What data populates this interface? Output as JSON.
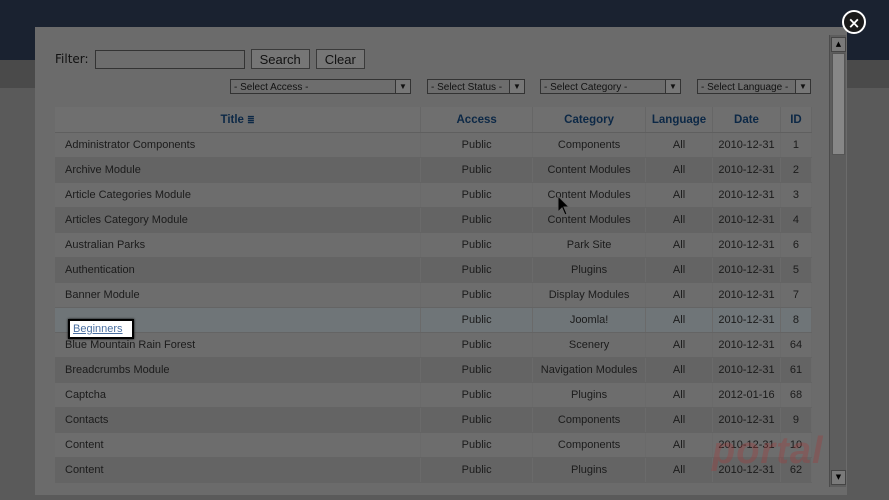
{
  "filter": {
    "label": "Filter:",
    "value": "",
    "placeholder": "",
    "search_label": "Search",
    "clear_label": "Clear"
  },
  "selects": {
    "access": "- Select Access -",
    "status": "- Select Status -",
    "category": "- Select Category -",
    "language": "- Select Language -"
  },
  "table": {
    "headers": {
      "title": "Title",
      "access": "Access",
      "category": "Category",
      "language": "Language",
      "date": "Date",
      "id": "ID"
    },
    "rows": [
      {
        "title": "Administrator Components",
        "access": "Public",
        "category": "Components",
        "language": "All",
        "date": "2010-12-31",
        "id": "1"
      },
      {
        "title": "Archive Module",
        "access": "Public",
        "category": "Content Modules",
        "language": "All",
        "date": "2010-12-31",
        "id": "2"
      },
      {
        "title": "Article Categories Module",
        "access": "Public",
        "category": "Content Modules",
        "language": "All",
        "date": "2010-12-31",
        "id": "3"
      },
      {
        "title": "Articles Category Module",
        "access": "Public",
        "category": "Content Modules",
        "language": "All",
        "date": "2010-12-31",
        "id": "4"
      },
      {
        "title": "Australian Parks",
        "access": "Public",
        "category": "Park Site",
        "language": "All",
        "date": "2010-12-31",
        "id": "6"
      },
      {
        "title": "Authentication",
        "access": "Public",
        "category": "Plugins",
        "language": "All",
        "date": "2010-12-31",
        "id": "5"
      },
      {
        "title": "Banner Module",
        "access": "Public",
        "category": "Display Modules",
        "language": "All",
        "date": "2010-12-31",
        "id": "7"
      },
      {
        "title": "",
        "access": "Public",
        "category": "Joomla!",
        "language": "All",
        "date": "2010-12-31",
        "id": "8"
      },
      {
        "title": "Blue Mountain Rain Forest",
        "access": "Public",
        "category": "Scenery",
        "language": "All",
        "date": "2010-12-31",
        "id": "64"
      },
      {
        "title": "Breadcrumbs Module",
        "access": "Public",
        "category": "Navigation Modules",
        "language": "All",
        "date": "2010-12-31",
        "id": "61"
      },
      {
        "title": "Captcha",
        "access": "Public",
        "category": "Plugins",
        "language": "All",
        "date": "2012-01-16",
        "id": "68"
      },
      {
        "title": "Contacts",
        "access": "Public",
        "category": "Components",
        "language": "All",
        "date": "2010-12-31",
        "id": "9"
      },
      {
        "title": "Content",
        "access": "Public",
        "category": "Components",
        "language": "All",
        "date": "2010-12-31",
        "id": "10"
      },
      {
        "title": "Content",
        "access": "Public",
        "category": "Plugins",
        "language": "All",
        "date": "2010-12-31",
        "id": "62"
      }
    ]
  },
  "highlight_link": "Beginners",
  "watermark": "portal",
  "colors": {
    "overlay": "#6b6b6b",
    "header_text": "#0c2846",
    "link": "#4a6fa0"
  }
}
